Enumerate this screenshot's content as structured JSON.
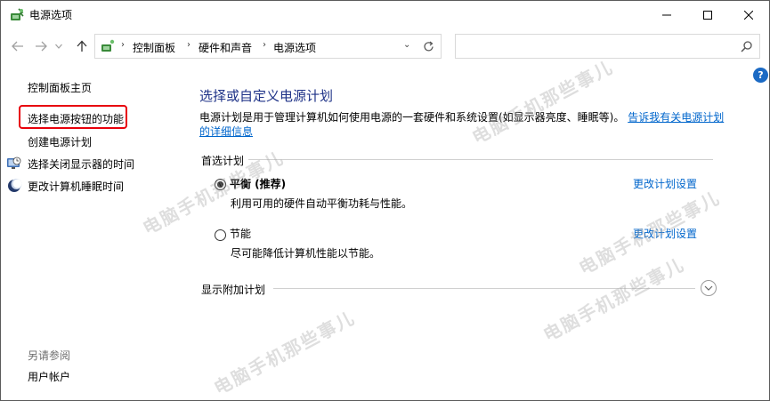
{
  "window": {
    "title": "电源选项"
  },
  "nav": {
    "breadcrumbs": [
      "控制面板",
      "硬件和声音",
      "电源选项"
    ],
    "search_placeholder": ""
  },
  "sidebar": {
    "home": "控制面板主页",
    "items": [
      {
        "label": "选择电源按钮的功能",
        "icon": "none"
      },
      {
        "label": "创建电源计划",
        "icon": "none"
      },
      {
        "label": "选择关闭显示器的时间",
        "icon": "display-clock-icon"
      },
      {
        "label": "更改计算机睡眠时间",
        "icon": "moon-icon"
      }
    ],
    "see_also_title": "另请参阅",
    "see_also_items": [
      "用户帐户"
    ]
  },
  "main": {
    "title": "选择或自定义电源计划",
    "description": "电源计划是用于管理计算机如何使用电源的一套硬件和系统设置(如显示器亮度、睡眠等)。",
    "description_link": "告诉我有关电源计划的详细信息",
    "preferred_group": "首选计划",
    "plans": [
      {
        "name": "平衡 (推荐)",
        "description": "利用可用的硬件自动平衡功耗与性能。",
        "link": "更改计划设置",
        "selected": true
      },
      {
        "name": "节能",
        "description": "尽可能降低计算机性能以节能。",
        "link": "更改计划设置",
        "selected": false
      }
    ],
    "extra_plans": "显示附加计划"
  },
  "help": {
    "label": "?"
  },
  "watermark": "电脑手机那些事儿",
  "colors": {
    "title": "#1e3287",
    "link": "#0066cc",
    "highlight": "#e8000b"
  }
}
